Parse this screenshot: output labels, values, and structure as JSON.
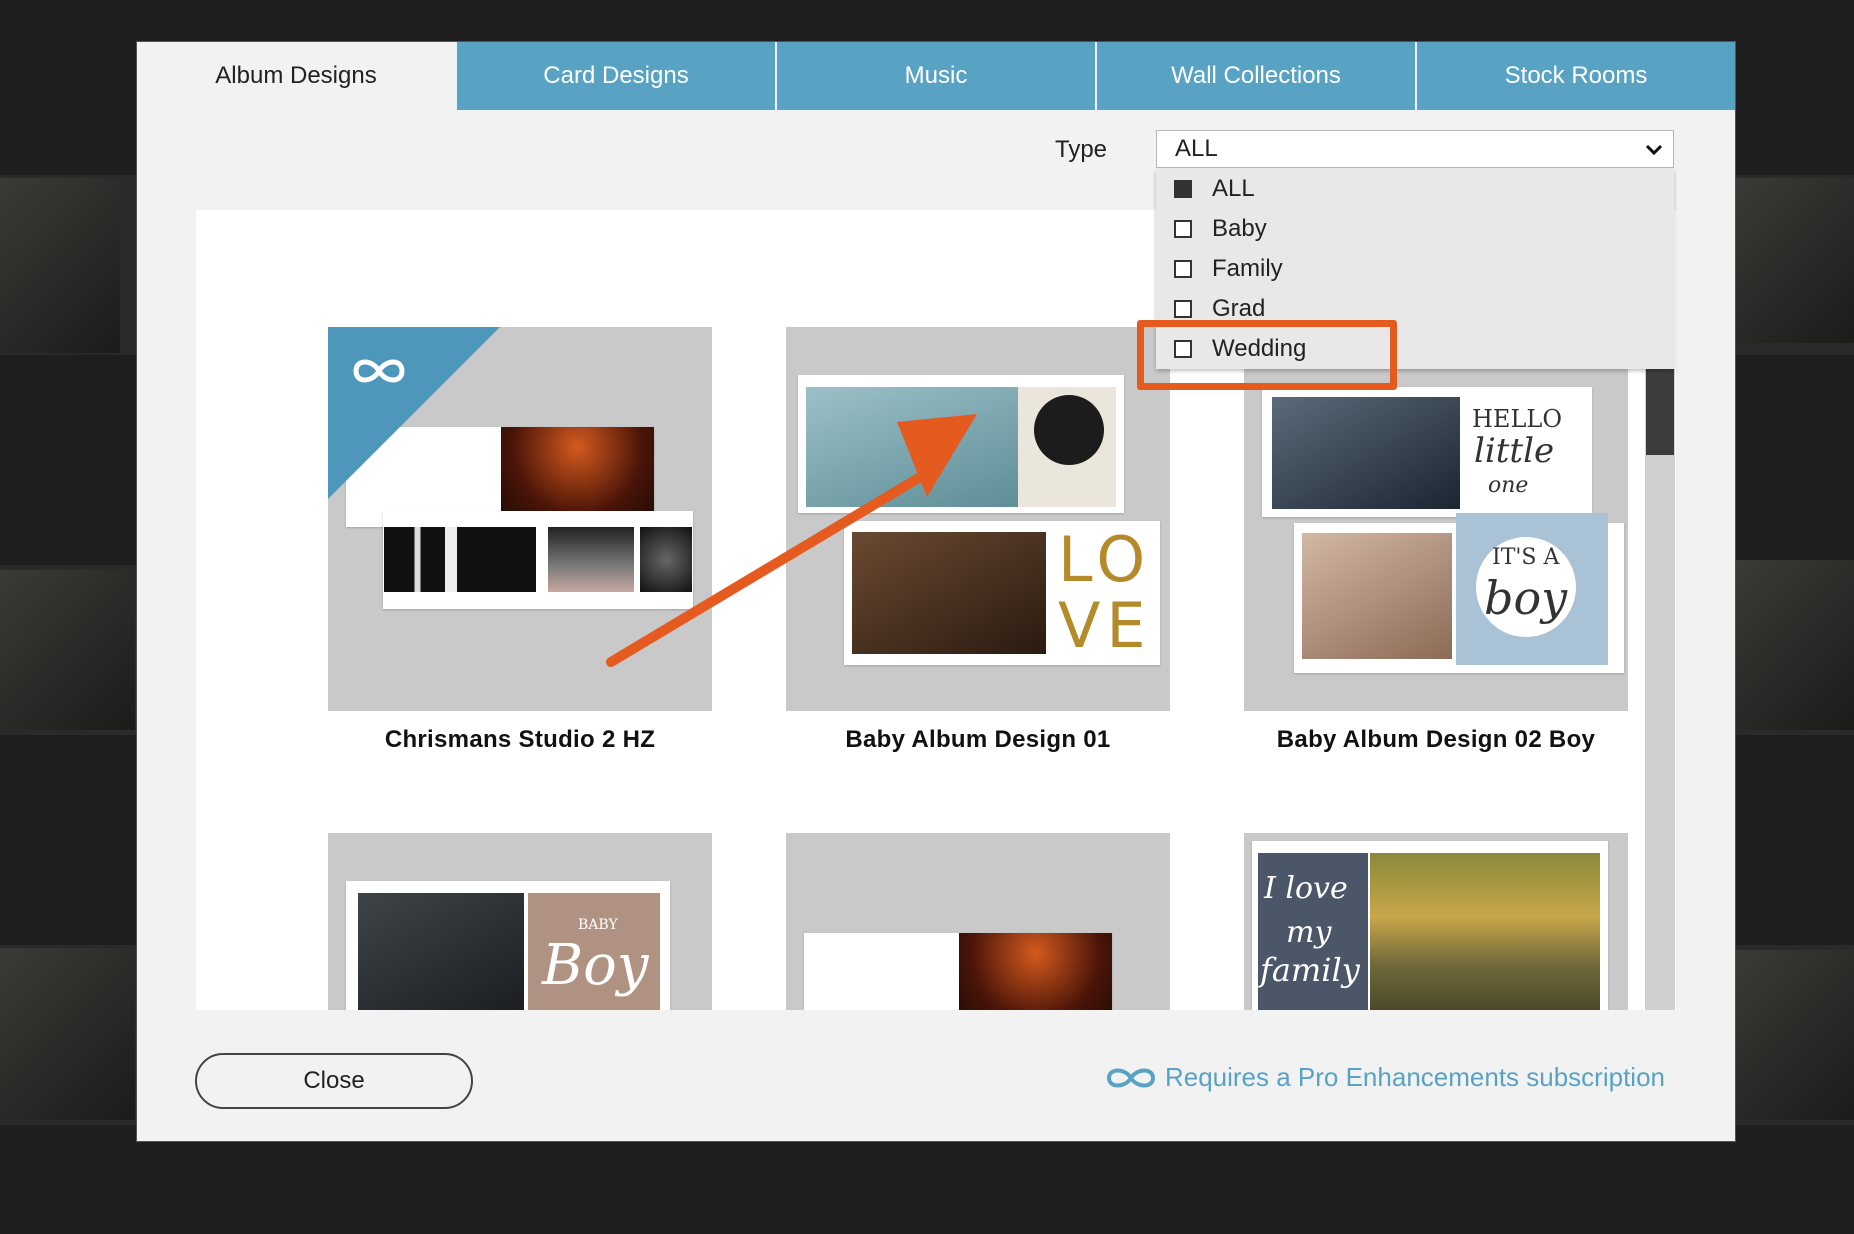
{
  "tabs": [
    {
      "label": "Album Designs",
      "active": true
    },
    {
      "label": "Card Designs",
      "active": false
    },
    {
      "label": "Music",
      "active": false
    },
    {
      "label": "Wall Collections",
      "active": false
    },
    {
      "label": "Stock Rooms",
      "active": false
    }
  ],
  "filter": {
    "label": "Type",
    "selected": "ALL",
    "options": [
      {
        "label": "ALL",
        "checked": true
      },
      {
        "label": "Baby",
        "checked": false
      },
      {
        "label": "Family",
        "checked": false
      },
      {
        "label": "Grad",
        "checked": false
      },
      {
        "label": "Wedding",
        "checked": false
      }
    ]
  },
  "designs": [
    {
      "title": "Chrismans Studio 2 HZ",
      "pro": true
    },
    {
      "title": "Baby Album Design 01",
      "pro": false
    },
    {
      "title": "Baby Album Design 02 Boy",
      "pro": false
    },
    {
      "title": "",
      "pro": false
    },
    {
      "title": "",
      "pro": false
    },
    {
      "title": "",
      "pro": false
    }
  ],
  "thumb_text": {
    "love_top": "LO",
    "love_bottom": "VE",
    "hello": "HELLO",
    "little": "little",
    "one": "one",
    "its_a": "IT'S A",
    "boy": "boy",
    "baby": "BABY",
    "boy2": "Boy",
    "i_love": "I love",
    "my": "my",
    "family": "family"
  },
  "footer": {
    "close_label": "Close",
    "pro_note": "Requires a Pro Enhancements subscription"
  },
  "colors": {
    "tab_blue": "#58a3c4",
    "highlight_orange": "#e55a1e",
    "pro_badge": "#4d98ba"
  }
}
